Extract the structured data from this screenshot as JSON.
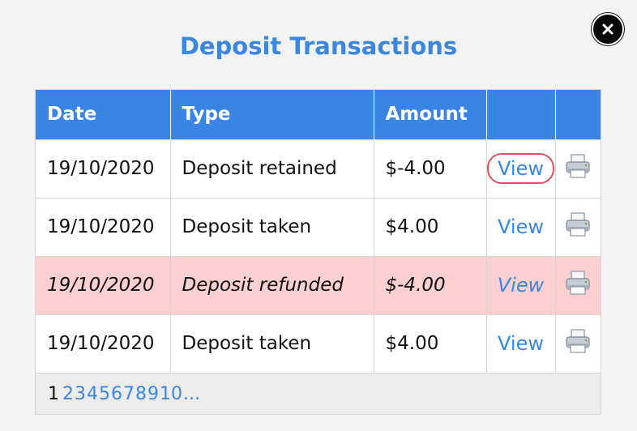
{
  "dialog": {
    "title": "Deposit Transactions"
  },
  "table": {
    "headers": [
      "Date",
      "Type",
      "Amount",
      "",
      ""
    ],
    "rows": [
      {
        "date": "19/10/2020",
        "type": "Deposit retained",
        "amount": "$-4.00",
        "view": "View",
        "print_icon": "printer-icon",
        "highlight": false
      },
      {
        "date": "19/10/2020",
        "type": "Deposit taken",
        "amount": "$4.00",
        "view": "View",
        "print_icon": "printer-icon",
        "highlight": false
      },
      {
        "date": "19/10/2020",
        "type": "Deposit refunded",
        "amount": "$-4.00",
        "view": "View",
        "print_icon": "printer-icon",
        "highlight": true
      },
      {
        "date": "19/10/2020",
        "type": "Deposit taken",
        "amount": "$4.00",
        "view": "View",
        "print_icon": "printer-icon",
        "highlight": false
      }
    ]
  },
  "pagination": {
    "current": "1",
    "pages": [
      "2",
      "3",
      "4",
      "5",
      "6",
      "7",
      "8",
      "9",
      "10",
      "..."
    ]
  },
  "colors": {
    "accent": "#3a87e0",
    "header_bg": "#3a84e3",
    "refund_row_bg": "#fcd0d0",
    "focus_ring": "#d9525e"
  },
  "icons": {
    "close": "close-icon",
    "print": "printer-icon"
  }
}
